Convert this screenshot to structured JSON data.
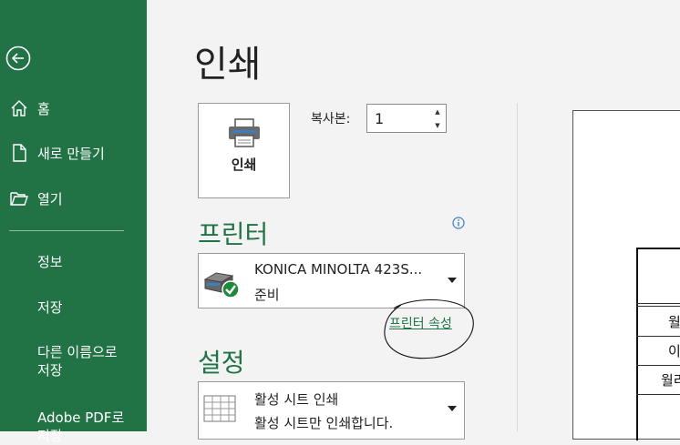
{
  "sidebar": {
    "back_icon": "back-arrow-icon",
    "home": "홈",
    "new": "새로 만들기",
    "open": "열기",
    "info": "정보",
    "save": "저장",
    "save_as_line1": "다른 이름으로",
    "save_as_line2": "저장",
    "adobe_line1": "Adobe PDF로",
    "adobe_line2": "저장"
  },
  "main": {
    "title": "인쇄",
    "print_button": "인쇄",
    "copies_label": "복사본:",
    "copies_value": "1",
    "printer_section": "프린터",
    "printer_name": "KONICA MINOLTA 423S...",
    "printer_status": "준비",
    "printer_properties": "프린터 속성",
    "settings_section": "설정",
    "setting_title": "활성 시트 인쇄",
    "setting_desc": "활성 시트만 인쇄합니다."
  },
  "preview": {
    "row1": "월",
    "row2": "이",
    "row3": "월리"
  },
  "colors": {
    "accent": "#217346",
    "sidebar_bg": "#217346",
    "page_bg": "#f3f3f3"
  }
}
